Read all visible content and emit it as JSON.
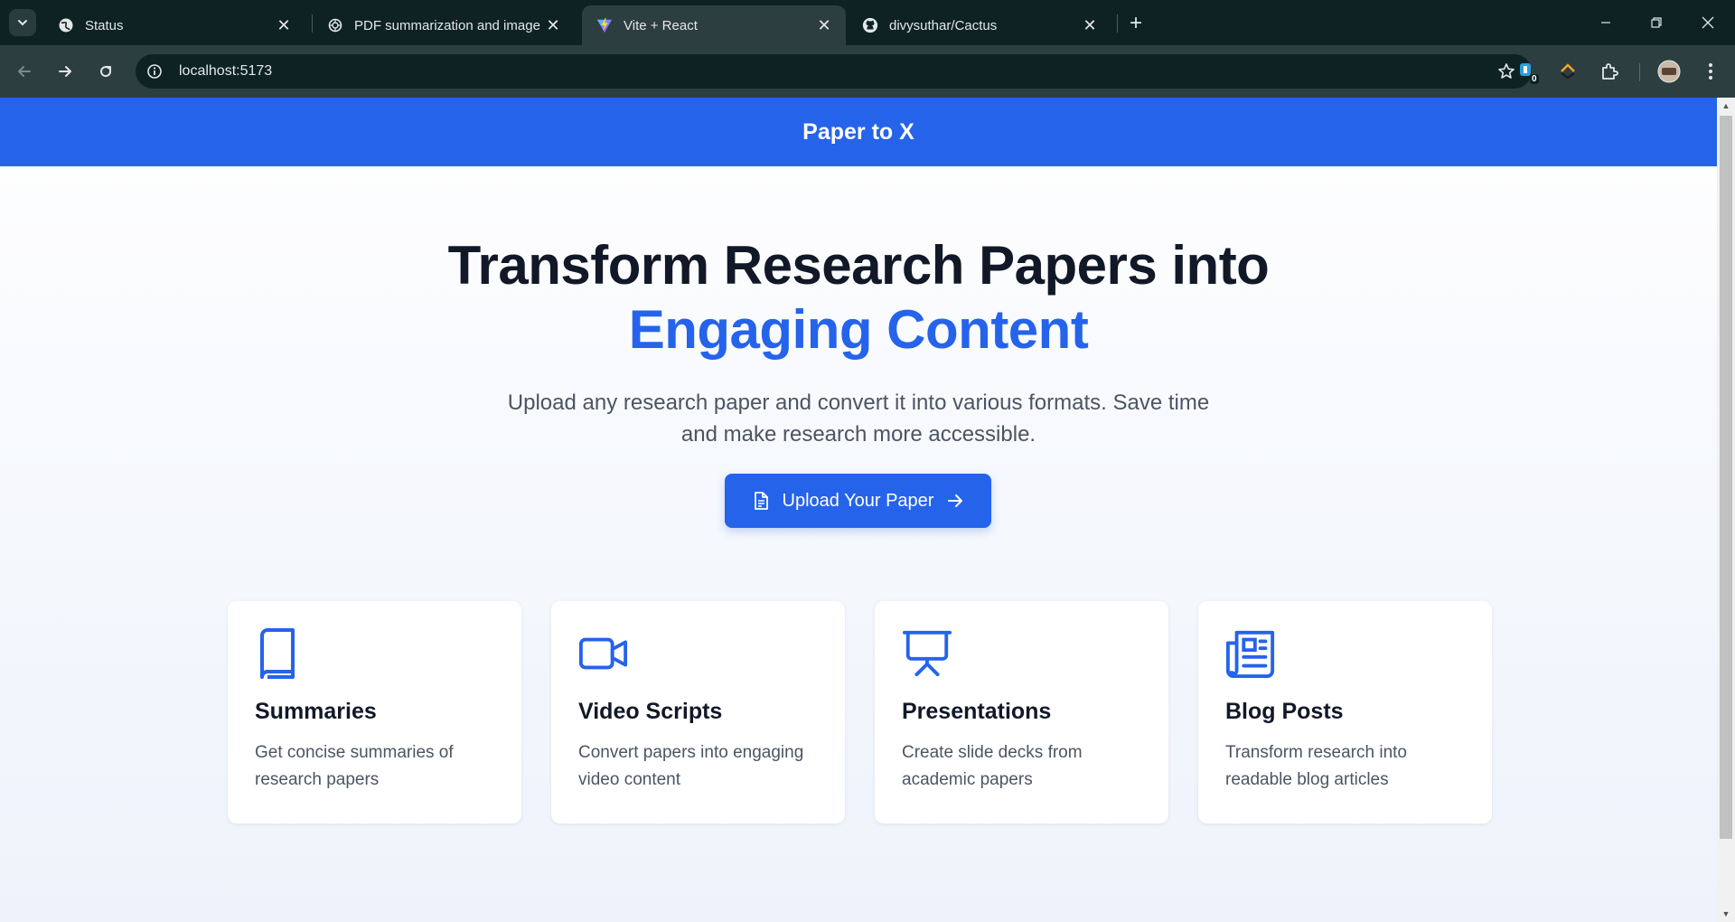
{
  "browser": {
    "tabs": [
      {
        "title": "Status",
        "favicon": "globe-icon",
        "active": false
      },
      {
        "title": "PDF summarization and image",
        "favicon": "openai-icon",
        "active": false
      },
      {
        "title": "Vite + React",
        "favicon": "vite-icon",
        "active": true
      },
      {
        "title": "divysuthar/Cactus",
        "favicon": "github-icon",
        "active": false
      }
    ],
    "url": "localhost:5173",
    "extension_badge": "0"
  },
  "app": {
    "brand": "Paper to X",
    "hero": {
      "title_line1": "Transform Research Papers into",
      "title_line2": "Engaging Content",
      "subtitle": "Upload any research paper and convert it into various formats. Save time and make research more accessible.",
      "cta_label": "Upload Your Paper"
    },
    "features": [
      {
        "icon": "book-icon",
        "title": "Summaries",
        "description": "Get concise summaries of research papers"
      },
      {
        "icon": "video-camera-icon",
        "title": "Video Scripts",
        "description": "Convert papers into engaging video content"
      },
      {
        "icon": "presentation-icon",
        "title": "Presentations",
        "description": "Create slide decks from academic papers"
      },
      {
        "icon": "newspaper-icon",
        "title": "Blog Posts",
        "description": "Transform research into readable blog articles"
      }
    ]
  },
  "colors": {
    "brand_blue": "#2563eb",
    "heading": "#111827",
    "body_text": "#4b5563",
    "chrome_dark": "#0e2224",
    "chrome_toolbar": "#2d3e40"
  }
}
